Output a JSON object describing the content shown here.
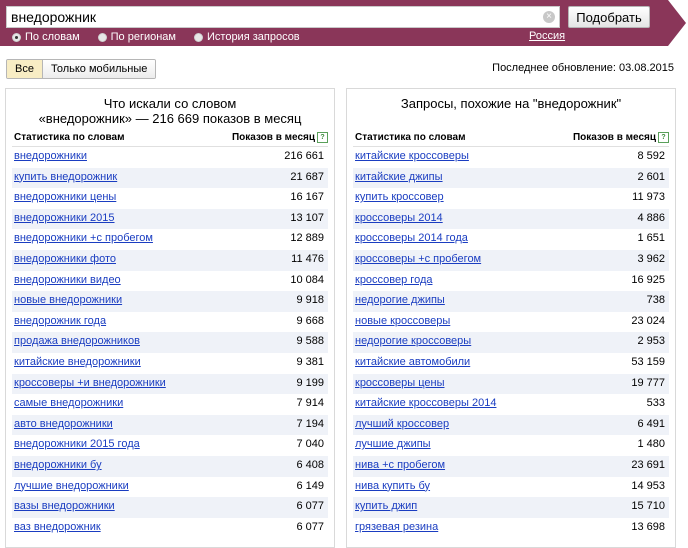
{
  "search": {
    "query": "внедорожник",
    "clear_icon": "×",
    "submit_label": "Подобрать",
    "modes": [
      {
        "label": "По словам",
        "selected": true
      },
      {
        "label": "По регионам",
        "selected": false
      },
      {
        "label": "История запросов",
        "selected": false
      }
    ],
    "region": "Россия"
  },
  "filters": {
    "tabs": [
      {
        "label": "Все",
        "active": true
      },
      {
        "label": "Только мобильные",
        "active": false
      }
    ],
    "updated": "Последнее обновление: 03.08.2015"
  },
  "left": {
    "title_line1": "Что искали со словом",
    "title_line2": "«внедорожник» — 216 669 показов в месяц",
    "col_words": "Статистика по словам",
    "col_shows": "Показов в месяц",
    "help": "?",
    "rows": [
      {
        "phrase": "внедорожники",
        "count": "216 661"
      },
      {
        "phrase": "купить внедорожник",
        "count": "21 687"
      },
      {
        "phrase": "внедорожники цены",
        "count": "16 167"
      },
      {
        "phrase": "внедорожники 2015",
        "count": "13 107"
      },
      {
        "phrase": "внедорожники +с пробегом",
        "count": "12 889"
      },
      {
        "phrase": "внедорожники фото",
        "count": "11 476"
      },
      {
        "phrase": "внедорожники видео",
        "count": "10 084"
      },
      {
        "phrase": "новые внедорожники",
        "count": "9 918"
      },
      {
        "phrase": "внедорожник года",
        "count": "9 668"
      },
      {
        "phrase": "продажа внедорожников",
        "count": "9 588"
      },
      {
        "phrase": "китайские внедорожники",
        "count": "9 381"
      },
      {
        "phrase": "кроссоверы +и внедорожники",
        "count": "9 199"
      },
      {
        "phrase": "самые внедорожники",
        "count": "7 914"
      },
      {
        "phrase": "авто внедорожники",
        "count": "7 194"
      },
      {
        "phrase": "внедорожники 2015 года",
        "count": "7 040"
      },
      {
        "phrase": "внедорожники бу",
        "count": "6 408"
      },
      {
        "phrase": "лучшие внедорожники",
        "count": "6 149"
      },
      {
        "phrase": "вазы внедорожники",
        "count": "6 077"
      },
      {
        "phrase": "ваз внедорожник",
        "count": "6 077"
      }
    ]
  },
  "right": {
    "title": "Запросы, похожие на \"внедорожник\"",
    "col_words": "Статистика по словам",
    "col_shows": "Показов в месяц",
    "help": "?",
    "rows": [
      {
        "phrase": "китайские кроссоверы",
        "count": "8 592"
      },
      {
        "phrase": "китайские джипы",
        "count": "2 601"
      },
      {
        "phrase": "купить кроссовер",
        "count": "11 973"
      },
      {
        "phrase": "кроссоверы 2014",
        "count": "4 886"
      },
      {
        "phrase": "кроссоверы 2014 года",
        "count": "1 651"
      },
      {
        "phrase": "кроссоверы +с пробегом",
        "count": "3 962"
      },
      {
        "phrase": "кроссовер года",
        "count": "16 925"
      },
      {
        "phrase": "недорогие джипы",
        "count": "738"
      },
      {
        "phrase": "новые кроссоверы",
        "count": "23 024"
      },
      {
        "phrase": "недорогие кроссоверы",
        "count": "2 953"
      },
      {
        "phrase": "китайские автомобили",
        "count": "53 159"
      },
      {
        "phrase": "кроссоверы цены",
        "count": "19 777"
      },
      {
        "phrase": "китайские кроссоверы 2014",
        "count": "533"
      },
      {
        "phrase": "лучший кроссовер",
        "count": "6 491"
      },
      {
        "phrase": "лучшие джипы",
        "count": "1 480"
      },
      {
        "phrase": "нива +с пробегом",
        "count": "23 691"
      },
      {
        "phrase": "нива купить бу",
        "count": "14 953"
      },
      {
        "phrase": "купить джип",
        "count": "15 710"
      },
      {
        "phrase": "грязевая резина",
        "count": "13 698"
      }
    ]
  },
  "colors": {
    "header": "#8a3659",
    "link": "#1a3dc1",
    "row_alt": "#eff2f8",
    "active_tab": "#f8edc4"
  }
}
